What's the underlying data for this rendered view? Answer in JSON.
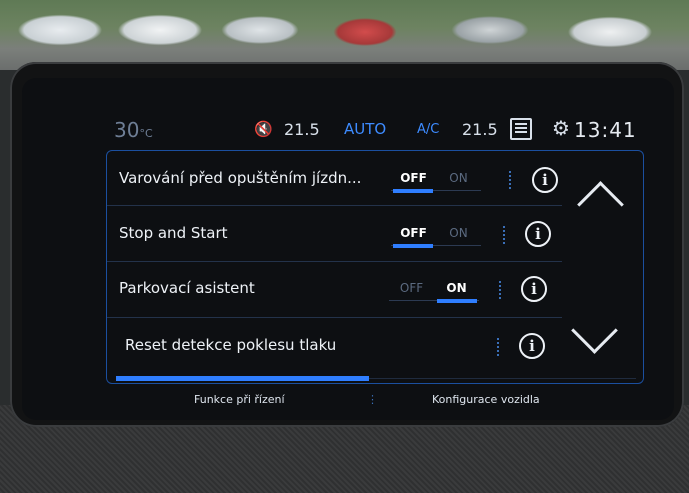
{
  "status_bar": {
    "outside_temp": "30",
    "outside_temp_unit": "°C",
    "mute_icon": "speaker-muted-icon",
    "temp_left": "21.5",
    "auto_label": "AUTO",
    "ac_label": "A/C",
    "temp_right": "21.5",
    "menu_icon": "list-menu-icon",
    "settings_icon": "gear-icon",
    "clock": "13:41"
  },
  "settings_rows": [
    {
      "label": "Varování před opuštěním jízdn...",
      "off_label": "OFF",
      "on_label": "ON",
      "value": "OFF"
    },
    {
      "label": "Stop and Start",
      "off_label": "OFF",
      "on_label": "ON",
      "value": "OFF"
    },
    {
      "label": "Parkovací asistent",
      "off_label": "OFF",
      "on_label": "ON",
      "value": "ON"
    },
    {
      "label": "Reset detekce poklesu tlaku",
      "value": null
    }
  ],
  "info_icon_glyph": "i",
  "scroll": {
    "up_icon": "chevron-up-icon",
    "down_icon": "chevron-down-icon"
  },
  "bottom_tabs": {
    "left": "Funkce při řízení",
    "right": "Konfigurace vozidla",
    "active": "left"
  },
  "colors": {
    "accent": "#2f7eff",
    "screen_bg": "#0d0f12",
    "text": "#eef2f7"
  }
}
